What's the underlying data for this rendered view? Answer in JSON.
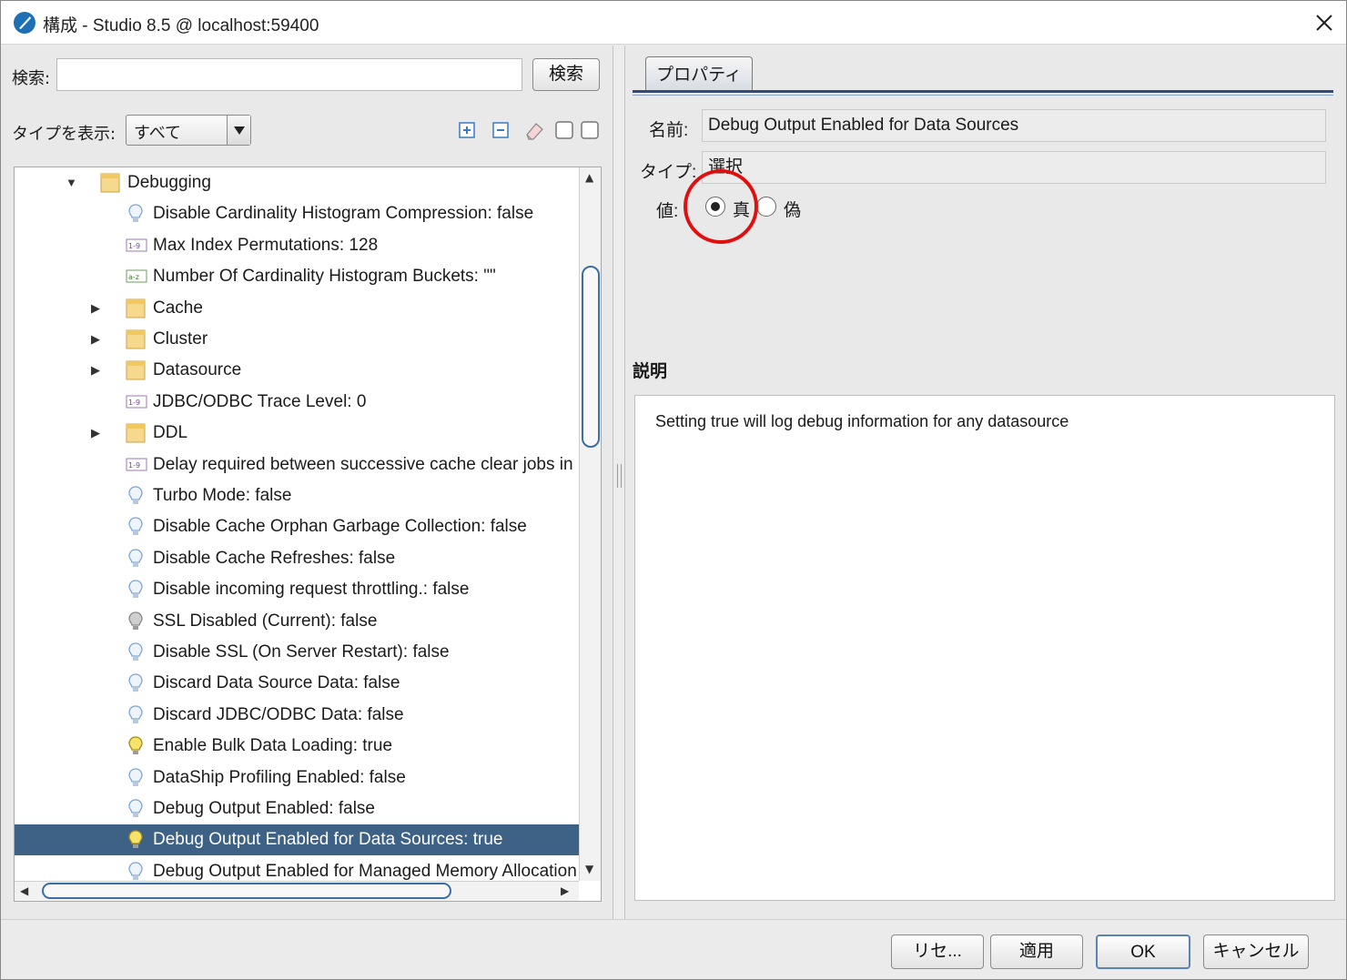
{
  "window": {
    "title": "構成 - Studio 8.5 @ localhost:59400",
    "icons": {
      "app": "app-icon",
      "close": "close-icon"
    }
  },
  "left": {
    "search_label": "検索:",
    "search_value": "",
    "search_button": "検索",
    "type_label": "タイプを表示:",
    "type_selected": "すべて",
    "toolbar_icons": [
      "expand-all-icon",
      "collapse-all-icon",
      "eraser-icon",
      "view-toggle-icon",
      "view-toggle-icon"
    ]
  },
  "tree": {
    "rows": [
      {
        "label": "Debugging",
        "icon": "folder",
        "expander": "open",
        "level": 0
      },
      {
        "label": "Disable Cardinality Histogram Compression: false",
        "icon": "bulb-off",
        "expander": "",
        "level": 1
      },
      {
        "label": "Max Index Permutations: 128",
        "icon": "numeric",
        "expander": "",
        "level": 1
      },
      {
        "label": "Number Of Cardinality Histogram Buckets: \"\"",
        "icon": "string",
        "expander": "",
        "level": 1
      },
      {
        "label": "Cache",
        "icon": "folder",
        "expander": "closed",
        "level": 1
      },
      {
        "label": "Cluster",
        "icon": "folder",
        "expander": "closed",
        "level": 1
      },
      {
        "label": "Datasource",
        "icon": "folder",
        "expander": "closed",
        "level": 1
      },
      {
        "label": "JDBC/ODBC Trace Level: 0",
        "icon": "numeric",
        "expander": "",
        "level": 1
      },
      {
        "label": "DDL",
        "icon": "folder",
        "expander": "closed",
        "level": 1
      },
      {
        "label": "Delay required between successive cache clear jobs in",
        "icon": "numeric",
        "expander": "",
        "level": 1
      },
      {
        "label": "Turbo Mode: false",
        "icon": "bulb-off",
        "expander": "",
        "level": 1
      },
      {
        "label": "Disable Cache Orphan Garbage Collection: false",
        "icon": "bulb-off",
        "expander": "",
        "level": 1
      },
      {
        "label": "Disable Cache Refreshes: false",
        "icon": "bulb-off",
        "expander": "",
        "level": 1
      },
      {
        "label": "Disable incoming request throttling.: false",
        "icon": "bulb-off",
        "expander": "",
        "level": 1
      },
      {
        "label": "SSL Disabled (Current): false",
        "icon": "bulb-gray",
        "expander": "",
        "level": 1
      },
      {
        "label": "Disable SSL (On Server Restart): false",
        "icon": "bulb-off",
        "expander": "",
        "level": 1
      },
      {
        "label": "Discard Data Source Data: false",
        "icon": "bulb-off",
        "expander": "",
        "level": 1
      },
      {
        "label": "Discard JDBC/ODBC Data: false",
        "icon": "bulb-off",
        "expander": "",
        "level": 1
      },
      {
        "label": "Enable Bulk Data Loading: true",
        "icon": "bulb-on",
        "expander": "",
        "level": 1
      },
      {
        "label": "DataShip Profiling Enabled: false",
        "icon": "bulb-off",
        "expander": "",
        "level": 1
      },
      {
        "label": "Debug Output Enabled: false",
        "icon": "bulb-off",
        "expander": "",
        "level": 1
      },
      {
        "label": "Debug Output Enabled for Data Sources: true",
        "icon": "bulb-on",
        "expander": "",
        "level": 1,
        "selected": true
      },
      {
        "label": "Debug Output Enabled for Managed Memory Allocation",
        "icon": "bulb-off",
        "expander": "",
        "level": 1
      }
    ]
  },
  "right": {
    "tab_label": "プロパティ",
    "name_label": "名前:",
    "name_value": "Debug Output Enabled for Data Sources",
    "type_label": "タイプ:",
    "type_value": "選択",
    "value_label": "値:",
    "radio_true": "真",
    "radio_false": "偽",
    "selected_value": "true",
    "desc_label": "説明",
    "desc_text": "Setting true will log debug information for any datasource",
    "highlight_color": "#e01010"
  },
  "buttons": {
    "reset": "リセ...",
    "apply": "適用",
    "ok": "OK",
    "cancel": "キャンセル"
  },
  "colors": {
    "selection": "#3d6285",
    "accent": "#2f4d7a"
  }
}
